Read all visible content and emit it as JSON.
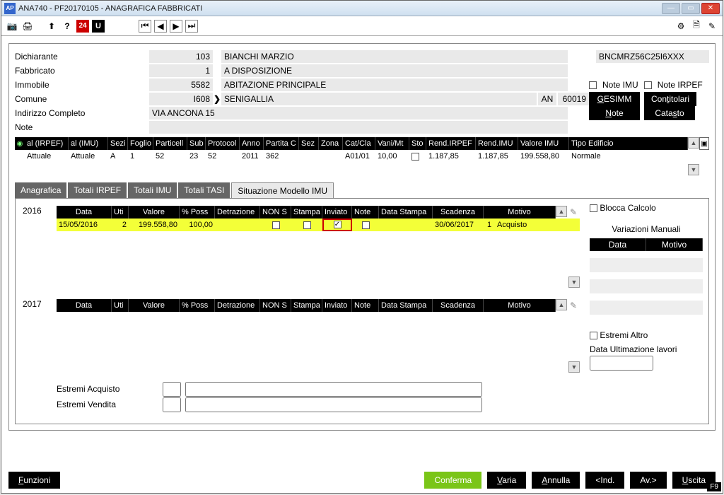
{
  "window": {
    "title": "ANA740  -  PF20170105  -   ANAGRAFICA FABBRICATI"
  },
  "toolbar_icons": {
    "camera": "📷",
    "print": "🖨",
    "upload": "⬆",
    "help": "?",
    "num": "24",
    "u": "U",
    "first": "⏮",
    "prev": "◀",
    "next": "▶",
    "last": "⏭",
    "cog": "⚙",
    "doc": "🗎",
    "edit": "✎"
  },
  "form": {
    "labels": {
      "dichiarante": "Dichiarante",
      "fabbricato": "Fabbricato",
      "immobile": "Immobile",
      "comune": "Comune",
      "indirizzo": "Indirizzo Completo",
      "note": "Note"
    },
    "dichiarante_cod": "103",
    "dichiarante_desc": "BIANCHI MARZIO",
    "cf": "BNCMRZ56C25I6XXX",
    "fabbricato_cod": "1",
    "fabbricato_desc": "A DISPOSIZIONE",
    "immobile_cod": "5582",
    "immobile_desc": "ABITAZIONE PRINCIPALE",
    "note_imu": "Note IMU",
    "note_irpef": "Note IRPEF",
    "comune_cod": "I608",
    "comune_desc": "SENIGALLIA",
    "prov": "AN",
    "cap": "60019",
    "indirizzo_val": "VIA ANCONA 15",
    "btn_gesimm": "GESIMM",
    "btn_contitolari": "Contitolari",
    "btn_note": "Note",
    "btn_catasto": "Catasto"
  },
  "grid1": {
    "headers": [
      "al (IRPEF)",
      "al (IMU)",
      "Sezi",
      "Foglio",
      "Particell",
      "Sub",
      "Protocol",
      "Anno",
      "Partita C",
      "Sez",
      "Zona",
      "Cat/Cla",
      "Vani/Mt",
      "Sto",
      "Rend.IRPEF",
      "Rend.IMU",
      "Valore IMU",
      "Tipo Edificio"
    ],
    "row": {
      "irpef": "Attuale",
      "imu": "Attuale",
      "sez": "A",
      "foglio": "1",
      "partic": "52",
      "sub": "23",
      "protoc": "52",
      "anno": "2011",
      "partita": "362",
      "sezc": "",
      "zona": "",
      "catcla": "A01/01",
      "vani": "10,00",
      "sto": "",
      "rendirpef": "1.187,85",
      "rendimu": "1.187,85",
      "valimu": "199.558,80",
      "tipo": "Normale"
    }
  },
  "tabs": {
    "anagrafica": "Anagrafica",
    "tot_irpef": "Totali IRPEF",
    "tot_imu": "Totali IMU",
    "tot_tasi": "Totali TASI",
    "situazione": "Situazione Modello IMU"
  },
  "year_labels": {
    "y2016": "2016",
    "y2017": "2017"
  },
  "grid2": {
    "headers": [
      "Data",
      "Uti",
      "Valore",
      "% Poss",
      "Detrazione",
      "NON S",
      "Stampa",
      "Inviato",
      "Note",
      "Data Stampa",
      "Scadenza",
      "Motivo"
    ],
    "row2016": {
      "data": "15/05/2016",
      "uti": "2",
      "valore": "199.558,80",
      "poss": "100,00",
      "scad": "30/06/2017",
      "num": "1",
      "mot": "Acquisto"
    }
  },
  "side": {
    "blocca": "Blocca Calcolo",
    "varman": "Variazioni Manuali",
    "hdr_data": "Data",
    "hdr_mot": "Motivo",
    "estremi_altro": "Estremi Altro",
    "data_ult": "Data Ultimazione lavori"
  },
  "estremi": {
    "acq": "Estremi Acquisto",
    "ven": "Estremi Vendita"
  },
  "bottom": {
    "funzioni": "Funzioni",
    "conferma": "Conferma",
    "varia": "Varia",
    "annulla": "Annulla",
    "ind": "<Ind.",
    "av": "Av.>",
    "uscita": "Uscita",
    "f9": "F9"
  }
}
